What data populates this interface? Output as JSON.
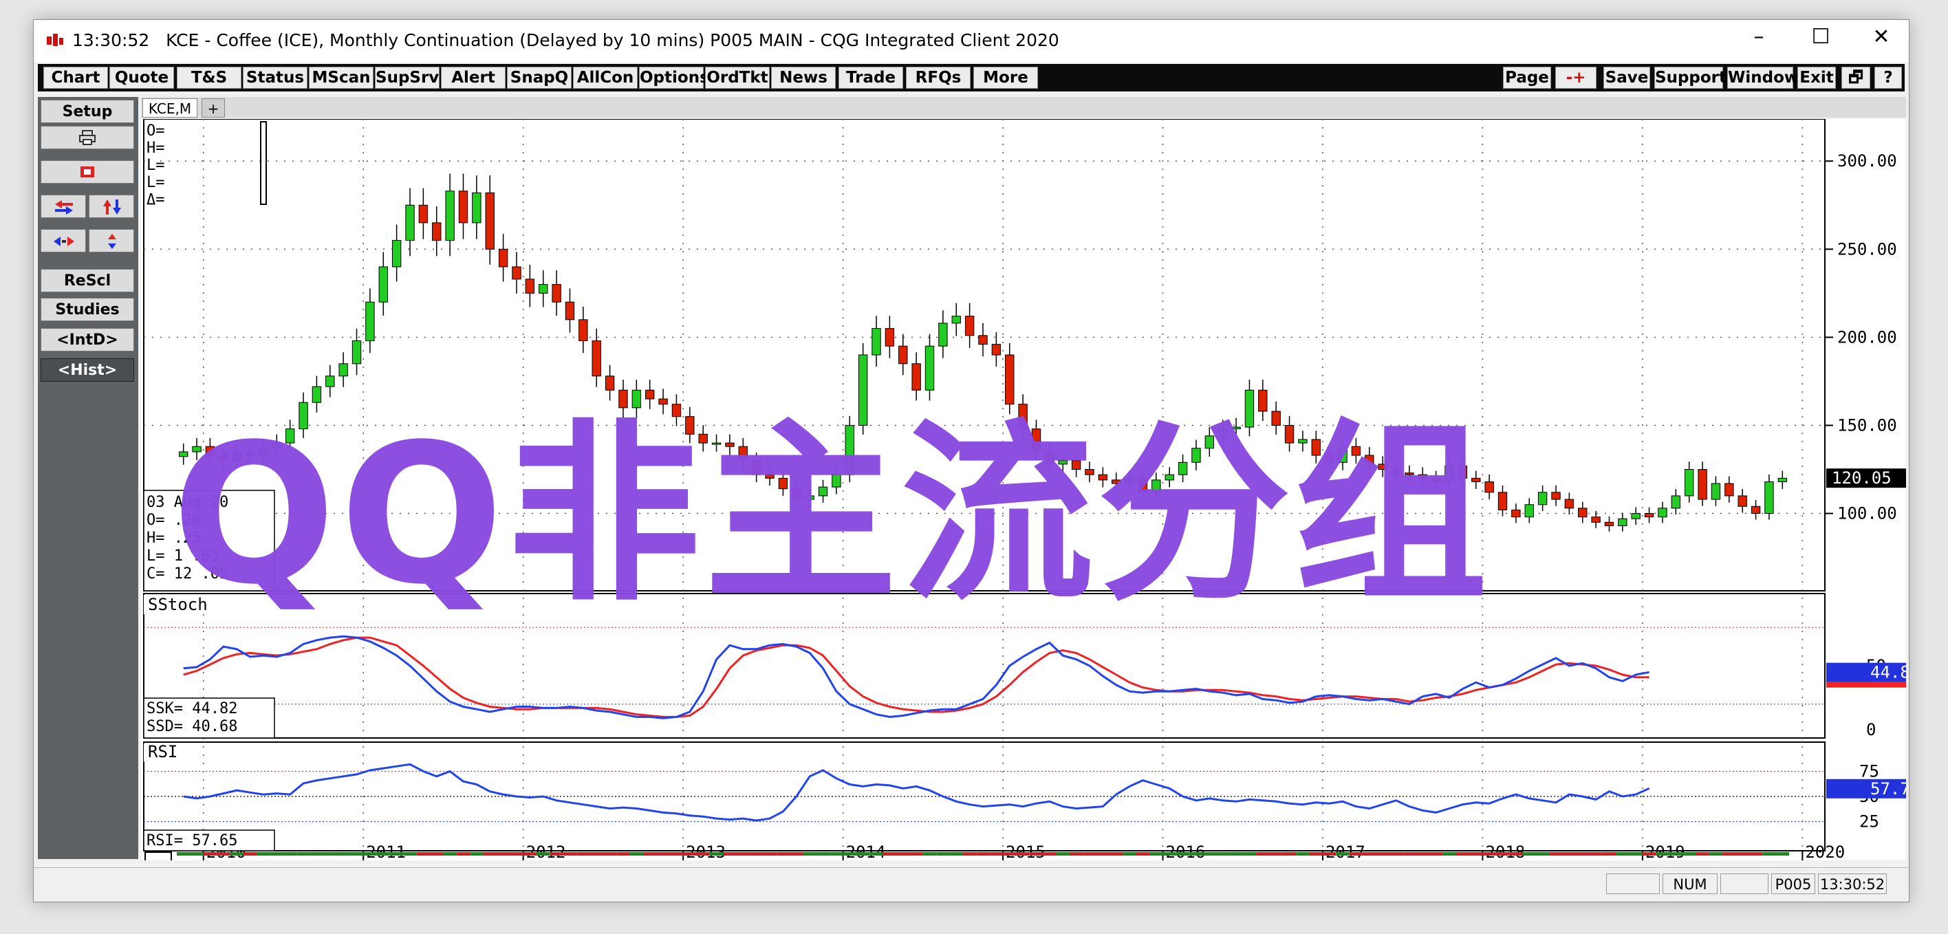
{
  "titlebar": {
    "time": "13:30:52",
    "title": "KCE - Coffee (ICE), Monthly Continuation (Delayed by 10 mins)   P005 MAIN - CQG Integrated Client 2020",
    "minimize": "–",
    "maximize": "☐",
    "close": "✕"
  },
  "toolbar": {
    "left": [
      "Chart",
      "Quote",
      "T&S",
      "Status",
      "MScan",
      "SupSrv",
      "Alert",
      "SnapQ",
      "AllCon",
      "Options",
      "OrdTkt",
      "News",
      "Trade",
      "RFQs",
      "More"
    ],
    "right": [
      "Page",
      "-+",
      "Save",
      "Support",
      "Window",
      "Exit",
      "🗗",
      "?"
    ]
  },
  "leftpanel": {
    "setup": "Setup",
    "rescl": "ReScl",
    "studies": "Studies",
    "intd": "<IntD>",
    "hist": "<Hist>"
  },
  "tabs": {
    "active": "KCE,M",
    "add": "+"
  },
  "colors": {
    "up": "#22cc22",
    "down": "#dd2200",
    "ssk": "#2244ee",
    "ssd": "#ee2222",
    "rsi": "#2244ee",
    "axis_badge": "#2233dd"
  },
  "watermark": "QQ非主流分组",
  "chart_data": [
    {
      "type": "candlestick",
      "price_axis": {
        "ylim": [
          60,
          320
        ],
        "ticks": [
          "300.00",
          "250.00",
          "200.00",
          "150.00",
          "100.00"
        ],
        "tick_values": [
          300,
          250,
          200,
          150,
          100
        ],
        "last": "120.05"
      },
      "x_labels": [
        "2010",
        "2011",
        "2012",
        "2013",
        "2014",
        "2015",
        "2016",
        "2017",
        "2018",
        "2019",
        "2020"
      ],
      "info_top": [
        "O=",
        "H=",
        "L=",
        "L=",
        "Δ="
      ],
      "info_bottom": [
        "03 Aug 20",
        "O=  .20",
        "H=  .25",
        "L=  1 .65",
        "C=  12 .05"
      ],
      "close": [
        135,
        138,
        133,
        130,
        134,
        133,
        137,
        140,
        148,
        163,
        172,
        178,
        185,
        198,
        220,
        240,
        255,
        275,
        265,
        255,
        283,
        265,
        282,
        250,
        240,
        233,
        225,
        230,
        220,
        210,
        198,
        178,
        170,
        160,
        170,
        165,
        162,
        155,
        145,
        140,
        140,
        138,
        130,
        122,
        120,
        114,
        108,
        110,
        115,
        122,
        150,
        190,
        205,
        195,
        185,
        170,
        195,
        208,
        212,
        201,
        196,
        190,
        162,
        148,
        135,
        128,
        130,
        125,
        122,
        119,
        117,
        120,
        112,
        119,
        122,
        129,
        137,
        144,
        148,
        149,
        170,
        158,
        150,
        140,
        142,
        133,
        129,
        138,
        133,
        128,
        125,
        123,
        122,
        120,
        118,
        127,
        120,
        118,
        112,
        102,
        98,
        105,
        112,
        108,
        103,
        98,
        95,
        93,
        97,
        100,
        98,
        103,
        110,
        125,
        108,
        117,
        110,
        104,
        100,
        118,
        120
      ],
      "ssk": [
        48,
        49,
        55,
        65,
        63,
        57,
        58,
        57,
        60,
        67,
        70,
        72,
        73,
        72,
        69,
        64,
        58,
        50,
        40,
        30,
        22,
        18,
        16,
        14,
        16,
        18,
        18,
        17,
        17,
        18,
        17,
        15,
        14,
        12,
        10,
        10,
        9,
        10,
        14,
        30,
        55,
        66,
        63,
        63,
        66,
        67,
        65,
        60,
        48,
        30,
        20,
        16,
        12,
        10,
        11,
        13,
        15,
        16,
        16,
        20,
        24,
        35,
        50,
        57,
        63,
        68,
        58,
        55,
        50,
        42,
        35,
        30,
        29,
        30,
        30,
        31,
        32,
        30,
        29,
        27,
        28,
        24,
        23,
        21,
        22,
        26,
        27,
        26,
        24,
        23,
        24,
        22,
        20,
        26,
        28,
        25,
        32,
        37,
        33,
        35,
        40,
        46,
        51,
        56,
        50,
        52,
        48,
        41,
        38,
        43,
        45
      ],
      "ssd": [
        43,
        46,
        51,
        56,
        59,
        60,
        59,
        58,
        59,
        61,
        63,
        67,
        70,
        72,
        72,
        69,
        66,
        58,
        50,
        41,
        32,
        25,
        21,
        18,
        17,
        16,
        16,
        17,
        17,
        17,
        17,
        17,
        16,
        14,
        12,
        11,
        10,
        10,
        11,
        18,
        32,
        48,
        58,
        62,
        64,
        66,
        66,
        64,
        58,
        46,
        34,
        26,
        21,
        18,
        16,
        15,
        14,
        14,
        15,
        17,
        20,
        26,
        35,
        45,
        53,
        60,
        62,
        60,
        55,
        49,
        43,
        37,
        33,
        31,
        30,
        30,
        31,
        31,
        31,
        30,
        29,
        27,
        26,
        24,
        23,
        24,
        25,
        26,
        26,
        25,
        24,
        24,
        22,
        23,
        25,
        26,
        28,
        31,
        33,
        35,
        37,
        41,
        46,
        51,
        52,
        51,
        50,
        47,
        43,
        41,
        41
      ],
      "ssk_last": "44.8",
      "stoch_ticks": [
        "50",
        "0"
      ],
      "stoch_tick_values": [
        50,
        0
      ],
      "stoch_labels": [
        "SStoch",
        "SSK=    44.82",
        "SSD=    40.68"
      ],
      "rsi": [
        50,
        48,
        50,
        53,
        56,
        54,
        52,
        53,
        52,
        63,
        66,
        68,
        70,
        72,
        76,
        78,
        80,
        82,
        75,
        70,
        75,
        65,
        62,
        55,
        52,
        50,
        49,
        50,
        46,
        44,
        42,
        40,
        38,
        39,
        38,
        36,
        34,
        33,
        31,
        30,
        28,
        27,
        28,
        26,
        28,
        35,
        50,
        70,
        76,
        68,
        62,
        60,
        62,
        61,
        58,
        60,
        56,
        50,
        45,
        42,
        40,
        41,
        42,
        40,
        43,
        45,
        40,
        38,
        39,
        40,
        52,
        60,
        66,
        62,
        58,
        50,
        46,
        48,
        46,
        45,
        47,
        46,
        45,
        43,
        42,
        44,
        43,
        45,
        40,
        38,
        42,
        46,
        40,
        36,
        34,
        38,
        42,
        44,
        43,
        48,
        52,
        48,
        46,
        44,
        52,
        50,
        47,
        55,
        50,
        52,
        58
      ],
      "rsi_last": "57.7",
      "rsi_ticks": [
        "75",
        "50",
        "25"
      ],
      "rsi_tick_values": [
        75,
        50,
        25
      ],
      "rsi_labels": [
        "RSI",
        "RSI=    57.65"
      ]
    }
  ],
  "status": {
    "num": "NUM",
    "page": "P005",
    "time": "13:30:52"
  }
}
